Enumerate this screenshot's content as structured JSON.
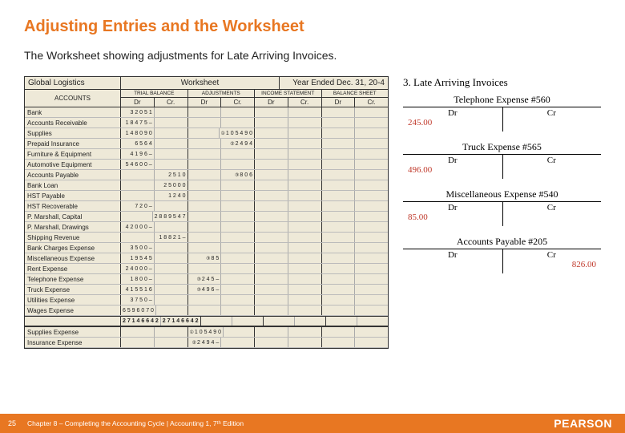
{
  "title": "Adjusting Entries and the Worksheet",
  "subtitle": "The Worksheet showing adjustments for Late Arriving Invoices.",
  "worksheet": {
    "company": "Global Logistics",
    "heading": "Worksheet",
    "period": "Year Ended Dec. 31, 20-4",
    "accounts_label": "ACCOUNTS",
    "groups": [
      "TRIAL BALANCE",
      "ADJUSTMENTS",
      "INCOME STATEMENT",
      "BALANCE SHEET"
    ],
    "dr": "Dr",
    "cr": "Cr.",
    "rows": [
      {
        "name": "Bank",
        "tb_dr": "3 2 0 5 1"
      },
      {
        "name": "Accounts Receivable",
        "tb_dr": "1 8 4 7 5 –"
      },
      {
        "name": "Supplies",
        "tb_dr": "1 4 8 0 9 0",
        "adj_cr": "1 0 5 4 9 0",
        "adj_lead": "①"
      },
      {
        "name": "Prepaid Insurance",
        "tb_dr": "6 5 6 4",
        "adj_cr": "2 4 9 4",
        "adj_lead": "②"
      },
      {
        "name": "Furniture & Equipment",
        "tb_dr": "4 1 9 6 –"
      },
      {
        "name": "Automotive Equipment",
        "tb_dr": "5 4 6 0 0 –"
      },
      {
        "name": "Accounts Payable",
        "tb_cr": "2 5 1 0",
        "adj_cr": "8 0 6",
        "adj_lead": "③"
      },
      {
        "name": "Bank Loan",
        "tb_cr": "2 5 0 0 0"
      },
      {
        "name": "HST Payable",
        "tb_cr": "1 2 4 0"
      },
      {
        "name": "HST Recoverable",
        "tb_dr": "7 2 0 –"
      },
      {
        "name": "P. Marshall, Capital",
        "tb_cr": "2 8 8 9 5 4 7"
      },
      {
        "name": "P. Marshall, Drawings",
        "tb_dr": "4 2 0 0 0 –"
      },
      {
        "name": "Shipping Revenue",
        "tb_cr": "1 8 8 2 1 –"
      },
      {
        "name": "Bank Charges Expense",
        "tb_dr": "3 5 0 0 –"
      },
      {
        "name": "Miscellaneous Expense",
        "tb_dr": "1 9 5 4 5",
        "adj_dr": "8 5",
        "adj_lead": "③"
      },
      {
        "name": "Rent Expense",
        "tb_dr": "2 4 0 0 0 –"
      },
      {
        "name": "Telephone Expense",
        "tb_dr": "1 8 0 0 –",
        "adj_dr": "2 4 5 –",
        "adj_lead": "③"
      },
      {
        "name": "Truck Expense",
        "tb_dr": "4 1 5 5 1 6",
        "adj_dr": "4 9 6 –",
        "adj_lead": "③"
      },
      {
        "name": "Utilities Expense",
        "tb_dr": "3 7 5 0 –"
      },
      {
        "name": "Wages Expense",
        "tb_dr": "6 5 9 6 0 7 0"
      }
    ],
    "totals": {
      "tb_dr": "2 7 1 4 6 6 4 2",
      "tb_cr": "2 7 1 4 6 6 4 2"
    },
    "extra_rows": [
      {
        "name": "Supplies Expense",
        "adj_dr": "1 0 5 4 9 0",
        "adj_lead": "①"
      },
      {
        "name": "Insurance Expense",
        "adj_dr": "2 4 9 4 –",
        "adj_lead": "②"
      }
    ]
  },
  "taccounts": {
    "heading": "3. Late Arriving Invoices",
    "dr": "Dr",
    "cr": "Cr",
    "accounts": [
      {
        "title": "Telephone Expense #560",
        "dr_val": "245.00"
      },
      {
        "title": "Truck Expense #565",
        "dr_val": "496.00"
      },
      {
        "title": "Miscellaneous Expense #540",
        "dr_val": "85.00"
      },
      {
        "title": "Accounts Payable #205",
        "cr_val": "826.00"
      }
    ]
  },
  "footer": {
    "page": "25",
    "text": "Chapter 8 – Completing the Accounting Cycle | Accounting 1, 7ᵗʰ Edition",
    "brand": "PEARSON"
  }
}
